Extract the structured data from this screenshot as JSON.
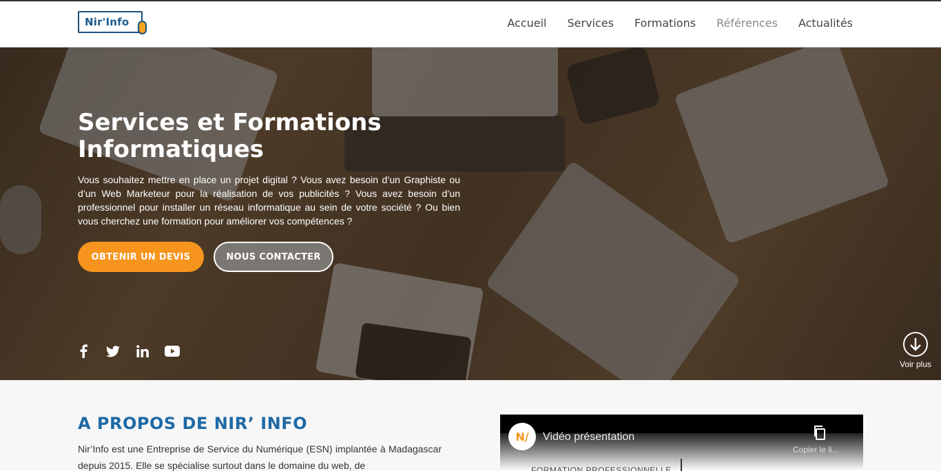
{
  "header": {
    "logo_text": "Nir'Info",
    "nav": [
      "Accueil",
      "Services",
      "Formations",
      "Références",
      "Actualités"
    ],
    "active_nav": "Références"
  },
  "hero": {
    "title": "Services et Formations Informatiques",
    "text": "Vous souhaitez mettre en place un projet digital ? Vous avez besoin d’un Graphiste ou d’un Web Marketeur pour la réalisation de vos publicités ? Vous avez besoin d’un professionnel pour installer un réseau informatique au sein de votre société ? Ou bien vous cherchez une formation pour améliorer vos compétences ?",
    "btn_quote": "OBTENIR UN DEVIS",
    "btn_contact": "NOUS CONTACTER",
    "socials": [
      "facebook-icon",
      "twitter-icon",
      "linkedin-icon",
      "youtube-icon"
    ],
    "more_label": "Voir plus"
  },
  "about": {
    "title": "A PROPOS DE NIR’ INFO",
    "text": "Nir’Info est une Entreprise de Service du Numérique (ESN) implantée à Madagascar depuis 2015. Elle se spécialise surtout dans le domaine du web, de"
  },
  "video": {
    "title": "Vidéo présentation",
    "copy_label": "Copier le li...",
    "caption": "FORMATION PROFESSIONNELLE"
  },
  "colors": {
    "accent": "#f7941d",
    "brand_blue": "#1f6aa5"
  }
}
